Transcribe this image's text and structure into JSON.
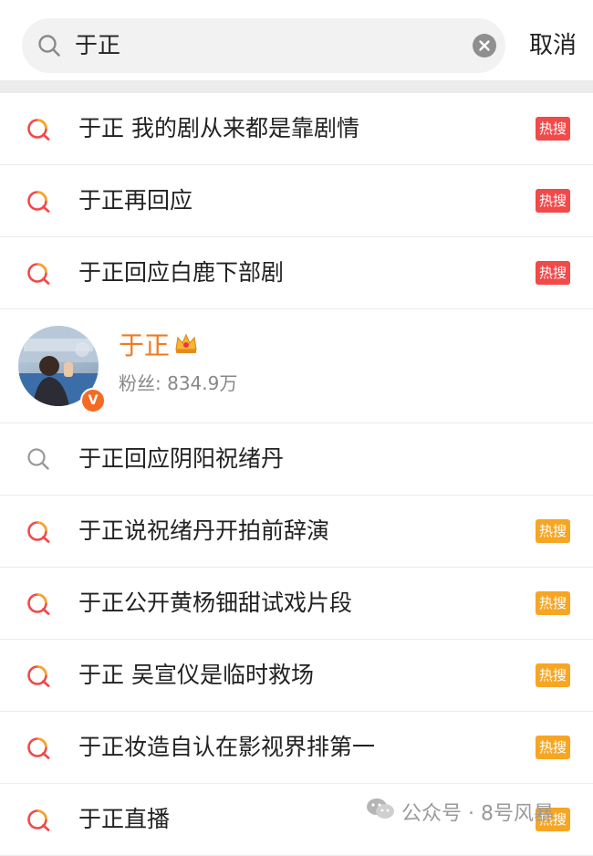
{
  "search": {
    "query": "于正",
    "cancel_label": "取消"
  },
  "suggestions_top": [
    {
      "text": "于正 我的剧从来都是靠剧情",
      "badge": "热搜",
      "badge_color": "#f04a4a",
      "icon": "hot-search-icon"
    },
    {
      "text": "于正再回应",
      "badge": "热搜",
      "badge_color": "#f04a4a",
      "icon": "hot-search-icon"
    },
    {
      "text": "于正回应白鹿下部剧",
      "badge": "热搜",
      "badge_color": "#f04a4a",
      "icon": "hot-search-icon"
    }
  ],
  "user": {
    "name": "于正",
    "fans_label": "粉丝: 834.9万",
    "verified_badge": "V"
  },
  "suggestions_bottom": [
    {
      "text": "于正回应阴阳祝绪丹",
      "badge": "",
      "icon": "search-icon"
    },
    {
      "text": "于正说祝绪丹开拍前辞演",
      "badge": "热搜",
      "badge_color": "#f6a623",
      "icon": "hot-search-icon"
    },
    {
      "text": "于正公开黄杨钿甜试戏片段",
      "badge": "热搜",
      "badge_color": "#f6a623",
      "icon": "hot-search-icon"
    },
    {
      "text": "于正 吴宣仪是临时救场",
      "badge": "热搜",
      "badge_color": "#f6a623",
      "icon": "hot-search-icon"
    },
    {
      "text": "于正妆造自认在影视界排第一",
      "badge": "热搜",
      "badge_color": "#f6a623",
      "icon": "hot-search-icon"
    },
    {
      "text": "于正直播",
      "badge": "热搜",
      "badge_color": "#f6a623",
      "icon": "hot-search-icon"
    }
  ],
  "watermark": {
    "text": "公众号 · 8号风暴"
  }
}
